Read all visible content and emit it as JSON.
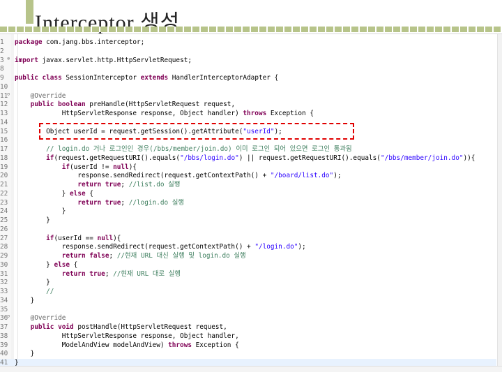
{
  "slide": {
    "title": "Interceptor 생성"
  },
  "editor": {
    "lines": [
      {
        "n": "1",
        "fold": "",
        "tokens": [
          {
            "t": "package",
            "k": "kw"
          },
          {
            "t": " com.jang.bbs.interceptor;",
            "k": "pl"
          }
        ]
      },
      {
        "n": "2",
        "fold": "",
        "tokens": []
      },
      {
        "n": "3",
        "fold": "⊕",
        "tokens": [
          {
            "t": "import",
            "k": "kw"
          },
          {
            "t": " javax.servlet.http.HttpServletRequest;",
            "k": "pl"
          }
        ]
      },
      {
        "n": "8",
        "fold": "",
        "tokens": []
      },
      {
        "n": "9",
        "fold": "",
        "tokens": [
          {
            "t": "public class",
            "k": "kw"
          },
          {
            "t": " SessionInterceptor ",
            "k": "pl"
          },
          {
            "t": "extends",
            "k": "kw"
          },
          {
            "t": " HandlerInterceptorAdapter {",
            "k": "pl"
          }
        ]
      },
      {
        "n": "10",
        "fold": "",
        "tokens": []
      },
      {
        "n": "11",
        "fold": "⊖",
        "tokens": [
          {
            "t": "    @Override",
            "k": "an"
          }
        ]
      },
      {
        "n": "12",
        "fold": "",
        "tokens": [
          {
            "t": "    ",
            "k": "pl"
          },
          {
            "t": "public boolean",
            "k": "kw"
          },
          {
            "t": " preHandle(HttpServletRequest request,",
            "k": "pl"
          }
        ]
      },
      {
        "n": "13",
        "fold": "",
        "tokens": [
          {
            "t": "            HttpServletResponse response, Object handler) ",
            "k": "pl"
          },
          {
            "t": "throws",
            "k": "kw"
          },
          {
            "t": " Exception {",
            "k": "pl"
          }
        ]
      },
      {
        "n": "14",
        "fold": "",
        "tokens": []
      },
      {
        "n": "15",
        "fold": "",
        "tokens": [
          {
            "t": "        Object userId = request.getSession().getAttribute(",
            "k": "pl"
          },
          {
            "t": "\"userId\"",
            "k": "str"
          },
          {
            "t": ");",
            "k": "pl"
          }
        ]
      },
      {
        "n": "16",
        "fold": "",
        "tokens": []
      },
      {
        "n": "17",
        "fold": "",
        "tokens": [
          {
            "t": "        // login.do 거나 로그인인 경우(/bbs/member/join.do) 이미 로그인 되어 있으면 로그인 통과됨",
            "k": "cm"
          }
        ]
      },
      {
        "n": "18",
        "fold": "",
        "tokens": [
          {
            "t": "        ",
            "k": "pl"
          },
          {
            "t": "if",
            "k": "kw"
          },
          {
            "t": "(request.getRequestURI().equals(",
            "k": "pl"
          },
          {
            "t": "\"/bbs/login.do\"",
            "k": "str"
          },
          {
            "t": ") || request.getRequestURI().equals(",
            "k": "pl"
          },
          {
            "t": "\"/bbs/member/join.do\"",
            "k": "str"
          },
          {
            "t": ")){",
            "k": "pl"
          }
        ]
      },
      {
        "n": "19",
        "fold": "",
        "tokens": [
          {
            "t": "            ",
            "k": "pl"
          },
          {
            "t": "if",
            "k": "kw"
          },
          {
            "t": "(userId != ",
            "k": "pl"
          },
          {
            "t": "null",
            "k": "kw"
          },
          {
            "t": "){",
            "k": "pl"
          }
        ]
      },
      {
        "n": "20",
        "fold": "",
        "tokens": [
          {
            "t": "                response.sendRedirect(request.getContextPath() + ",
            "k": "pl"
          },
          {
            "t": "\"/board/list.do\"",
            "k": "str"
          },
          {
            "t": ");",
            "k": "pl"
          }
        ]
      },
      {
        "n": "21",
        "fold": "",
        "tokens": [
          {
            "t": "                ",
            "k": "pl"
          },
          {
            "t": "return true",
            "k": "kw"
          },
          {
            "t": "; ",
            "k": "pl"
          },
          {
            "t": "//list.do 실행",
            "k": "cm"
          }
        ]
      },
      {
        "n": "22",
        "fold": "",
        "tokens": [
          {
            "t": "            } ",
            "k": "pl"
          },
          {
            "t": "else",
            "k": "kw"
          },
          {
            "t": " {",
            "k": "pl"
          }
        ]
      },
      {
        "n": "23",
        "fold": "",
        "tokens": [
          {
            "t": "                ",
            "k": "pl"
          },
          {
            "t": "return true",
            "k": "kw"
          },
          {
            "t": "; ",
            "k": "pl"
          },
          {
            "t": "//login.do 실행",
            "k": "cm"
          }
        ]
      },
      {
        "n": "24",
        "fold": "",
        "tokens": [
          {
            "t": "            }",
            "k": "pl"
          }
        ]
      },
      {
        "n": "25",
        "fold": "",
        "tokens": [
          {
            "t": "        }",
            "k": "pl"
          }
        ]
      },
      {
        "n": "26",
        "fold": "",
        "tokens": []
      },
      {
        "n": "27",
        "fold": "",
        "tokens": [
          {
            "t": "        ",
            "k": "pl"
          },
          {
            "t": "if",
            "k": "kw"
          },
          {
            "t": "(userId == ",
            "k": "pl"
          },
          {
            "t": "null",
            "k": "kw"
          },
          {
            "t": "){",
            "k": "pl"
          }
        ]
      },
      {
        "n": "28",
        "fold": "",
        "tokens": [
          {
            "t": "            response.sendRedirect(request.getContextPath() + ",
            "k": "pl"
          },
          {
            "t": "\"/login.do\"",
            "k": "str"
          },
          {
            "t": ");",
            "k": "pl"
          }
        ]
      },
      {
        "n": "29",
        "fold": "",
        "tokens": [
          {
            "t": "            ",
            "k": "pl"
          },
          {
            "t": "return false",
            "k": "kw"
          },
          {
            "t": "; ",
            "k": "pl"
          },
          {
            "t": "//현재 URL 대신 실행 및 login.do 실행",
            "k": "cm"
          }
        ]
      },
      {
        "n": "30",
        "fold": "",
        "tokens": [
          {
            "t": "        } ",
            "k": "pl"
          },
          {
            "t": "else",
            "k": "kw"
          },
          {
            "t": " {",
            "k": "pl"
          }
        ]
      },
      {
        "n": "31",
        "fold": "",
        "tokens": [
          {
            "t": "            ",
            "k": "pl"
          },
          {
            "t": "return true",
            "k": "kw"
          },
          {
            "t": "; ",
            "k": "pl"
          },
          {
            "t": "//현재 URL 대로 실행",
            "k": "cm"
          }
        ]
      },
      {
        "n": "32",
        "fold": "",
        "tokens": [
          {
            "t": "        }",
            "k": "pl"
          }
        ]
      },
      {
        "n": "33",
        "fold": "",
        "tokens": [
          {
            "t": "        //",
            "k": "cm"
          }
        ]
      },
      {
        "n": "34",
        "fold": "",
        "tokens": [
          {
            "t": "    }",
            "k": "pl"
          }
        ]
      },
      {
        "n": "35",
        "fold": "",
        "tokens": []
      },
      {
        "n": "36",
        "fold": "⊖",
        "tokens": [
          {
            "t": "    @Override",
            "k": "an"
          }
        ]
      },
      {
        "n": "37",
        "fold": "",
        "tokens": [
          {
            "t": "    ",
            "k": "pl"
          },
          {
            "t": "public void",
            "k": "kw"
          },
          {
            "t": " postHandle(HttpServletRequest request,",
            "k": "pl"
          }
        ]
      },
      {
        "n": "38",
        "fold": "",
        "tokens": [
          {
            "t": "            HttpServletResponse response, Object handler,",
            "k": "pl"
          }
        ]
      },
      {
        "n": "39",
        "fold": "",
        "tokens": [
          {
            "t": "            ModelAndView modelAndView) ",
            "k": "pl"
          },
          {
            "t": "throws",
            "k": "kw"
          },
          {
            "t": " Exception {",
            "k": "pl"
          }
        ]
      },
      {
        "n": "40",
        "fold": "",
        "tokens": [
          {
            "t": "    }",
            "k": "pl"
          }
        ]
      },
      {
        "n": "41",
        "fold": "",
        "tokens": [
          {
            "t": "}",
            "k": "pl"
          }
        ]
      }
    ],
    "current_line": "41"
  },
  "colors": {
    "keyword": "#7f0055",
    "string": "#2a00ff",
    "comment": "#3f7f5f",
    "annotation": "#646464",
    "highlight_box": "#e00000",
    "title_rule": "#b7c48a"
  }
}
